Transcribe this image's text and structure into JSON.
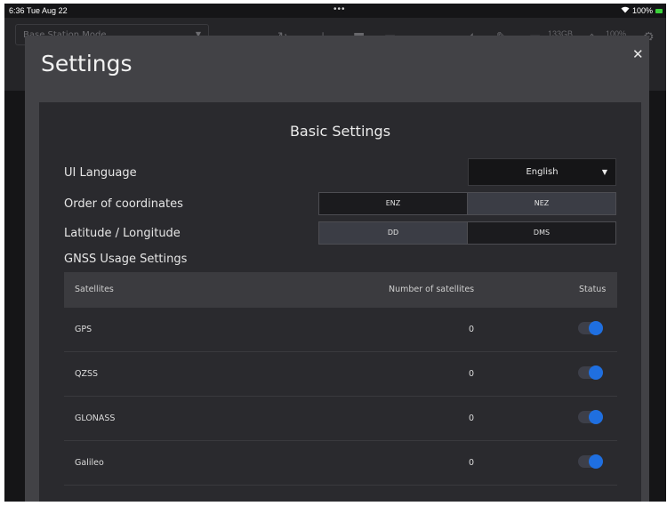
{
  "status_bar": {
    "time": "6:36",
    "date": "Tue Aug 22",
    "dots": "•••",
    "wifi_icon": "wifi-icon",
    "battery": "100%",
    "battery_color": "#3bd13b"
  },
  "app_bar": {
    "mode": "Base Station Mode",
    "storage": "133GB",
    "level": "100%"
  },
  "modal": {
    "title": "Settings",
    "close": "✕"
  },
  "basic": {
    "title": "Basic Settings",
    "ui_language_label": "UI Language",
    "ui_language_value": "English",
    "coord_order_label": "Order of coordinates",
    "coord_options": [
      "ENZ",
      "NEZ"
    ],
    "coord_selected": "NEZ",
    "latlon_label": "Latitude / Longitude",
    "latlon_options": [
      "DD",
      "DMS"
    ],
    "latlon_selected": "DD",
    "gnss_heading": "GNSS Usage Settings"
  },
  "gnss_table": {
    "headers": [
      "Satellites",
      "Number of satellites",
      "Status"
    ],
    "rows": [
      {
        "name": "GPS",
        "count": "0",
        "enabled": true
      },
      {
        "name": "QZSS",
        "count": "0",
        "enabled": true
      },
      {
        "name": "GLONASS",
        "count": "0",
        "enabled": true
      },
      {
        "name": "Galileo",
        "count": "0",
        "enabled": true
      }
    ]
  },
  "colors": {
    "toggle_on": "#1f6fe0",
    "modal_bg": "#424246",
    "panel_bg": "#2a2a2e"
  }
}
